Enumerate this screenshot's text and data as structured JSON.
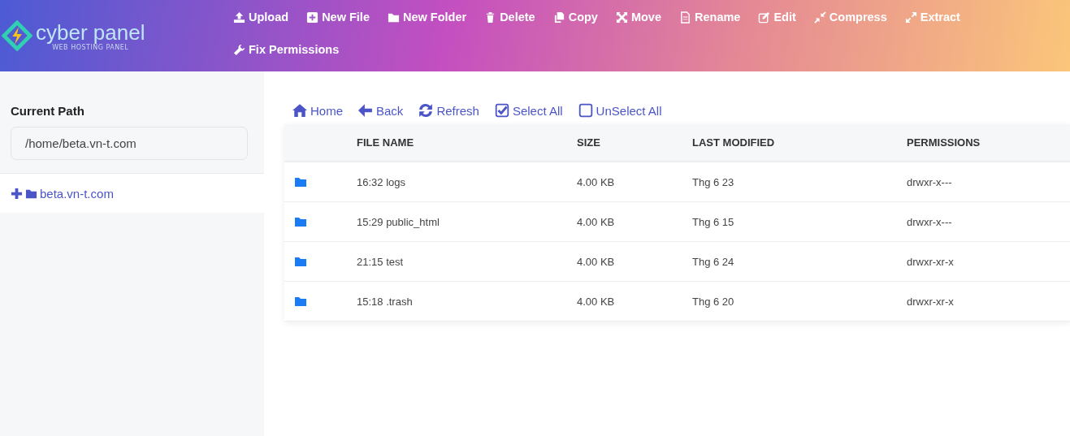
{
  "logo": {
    "name": "cyber panel",
    "tagline": "WEB HOSTING PANEL"
  },
  "actions": [
    {
      "kind": "upload",
      "label": "Upload"
    },
    {
      "kind": "plus",
      "label": "New File"
    },
    {
      "kind": "folder",
      "label": "New Folder"
    },
    {
      "kind": "trash",
      "label": "Delete"
    },
    {
      "kind": "copy",
      "label": "Copy"
    },
    {
      "kind": "move",
      "label": "Move"
    },
    {
      "kind": "file",
      "label": "Rename"
    },
    {
      "kind": "edit",
      "label": "Edit"
    },
    {
      "kind": "compress",
      "label": "Compress"
    },
    {
      "kind": "expand",
      "label": "Extract"
    },
    {
      "kind": "wrench",
      "label": "Fix Permissions"
    }
  ],
  "sidebar": {
    "title": "Current Path",
    "path": "/home/beta.vn-t.com",
    "tree": [
      {
        "label": "beta.vn-t.com",
        "expanded": false
      }
    ]
  },
  "nav": [
    {
      "kind": "home",
      "label": "Home"
    },
    {
      "kind": "back",
      "label": "Back"
    },
    {
      "kind": "refresh",
      "label": "Refresh"
    },
    {
      "kind": "check",
      "label": "Select All"
    },
    {
      "kind": "box",
      "label": "UnSelect All"
    }
  ],
  "table": {
    "columns": [
      "FILE NAME",
      "SIZE",
      "LAST MODIFIED",
      "PERMISSIONS"
    ],
    "rows": [
      {
        "name": "16:32 logs",
        "size": "4.00 KB",
        "modified": "Thg 6 23",
        "permissions": "drwxr-x---"
      },
      {
        "name": "15:29 public_html",
        "size": "4.00 KB",
        "modified": "Thg 6 15",
        "permissions": "drwxr-x---"
      },
      {
        "name": "21:15 test",
        "size": "4.00 KB",
        "modified": "Thg 6 24",
        "permissions": "drwxr-xr-x"
      },
      {
        "name": "15:18 .trash",
        "size": "4.00 KB",
        "modified": "Thg 6 20",
        "permissions": "drwxr-xr-x"
      }
    ]
  }
}
